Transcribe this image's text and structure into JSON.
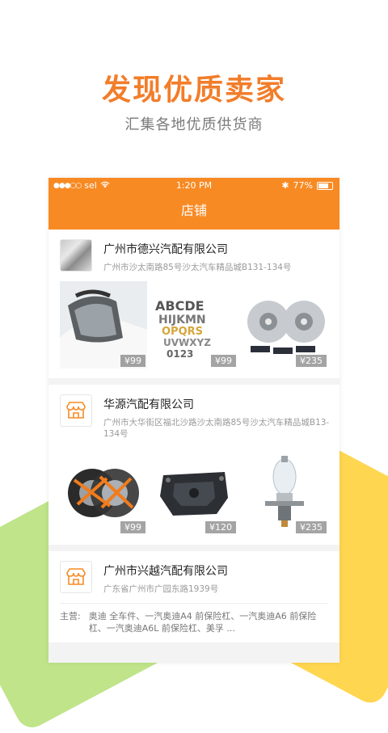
{
  "promo": {
    "headline": "发现优质卖家",
    "subline": "汇集各地优质供货商"
  },
  "statusbar": {
    "carrier": "sel",
    "time": "1:20 PM",
    "battery": "77%"
  },
  "navbar": {
    "title": "店铺"
  },
  "stores": [
    {
      "name": "广州市德兴汽配有限公司",
      "address": "广州市沙太南路85号沙太汽车精品城B131-134号",
      "products": [
        {
          "icon": "car-mirror-image",
          "price": "¥99"
        },
        {
          "icon": "chrome-letters-image",
          "price": "¥99"
        },
        {
          "icon": "brake-discs-image",
          "price": "¥235"
        }
      ]
    },
    {
      "name": "华源汽配有限公司",
      "address": "广州市大华街区福北沙路沙太南路85号沙太汽车精品城B13-134号",
      "products": [
        {
          "icon": "snow-chains-image",
          "price": "¥99"
        },
        {
          "icon": "skid-plate-image",
          "price": "¥120"
        },
        {
          "icon": "headlight-bulb-image",
          "price": "¥235"
        }
      ]
    },
    {
      "name": "广州市兴越汽配有限公司",
      "address": "广东省广州市广园东路1939号",
      "main_label": "主营:",
      "main_text": "奥迪 全车件、一汽奥迪A4 前保险杠、一汽奥迪A6 前保险杠、一汽奥迪A6L 前保险杠、美孚 ..."
    }
  ],
  "colors": {
    "accent": "#f88a24",
    "headline": "#f27d2a"
  }
}
